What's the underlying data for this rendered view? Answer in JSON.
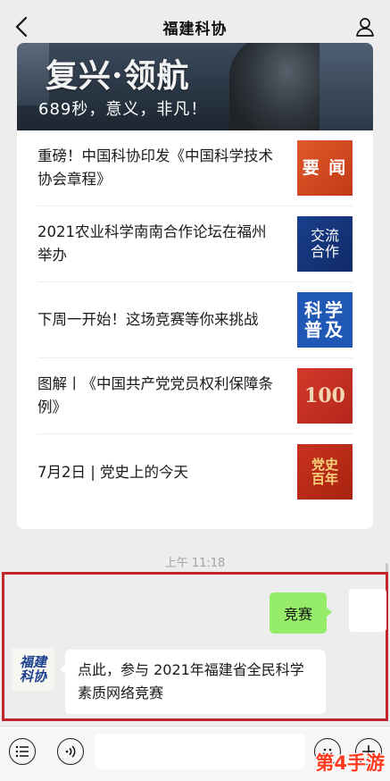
{
  "navbar": {
    "title": "福建科协",
    "back_icon": "chevron-left-icon",
    "user_icon": "person-icon"
  },
  "banner": {
    "title": "复兴·领航",
    "subtitle": "689秒，意义，非凡！"
  },
  "news": [
    {
      "text": "重磅！中国科协印发《中国科学技术协会章程》",
      "thumb": "要 闻"
    },
    {
      "text": "2021农业科学南南合作论坛在福州举办",
      "thumb": "交流合作"
    },
    {
      "text": "下周一开始！这场竞赛等你来挑战",
      "thumb": "科学普及"
    },
    {
      "text": "图解丨《中国共产党党员权利保障条例》",
      "thumb": "100"
    },
    {
      "text": "7月2日 | 党史上的今天",
      "thumb": "党史百年"
    }
  ],
  "timestamp": "上午 11:18",
  "chat": {
    "sent": "竞赛",
    "bot_logo": "福建科协",
    "reply": "点此，参与 2021年福建省全民科学素质网络竞赛"
  },
  "input_bar": {
    "menu_icon": "menu-list-icon",
    "voice_icon": "voice-icon",
    "emoji_icon": "emoji-icon",
    "plus_icon": "plus-icon"
  },
  "watermark": "第4手游",
  "colors": {
    "highlight_border": "#c0282c",
    "sent_bubble": "#95ec69",
    "background": "#ededed"
  }
}
